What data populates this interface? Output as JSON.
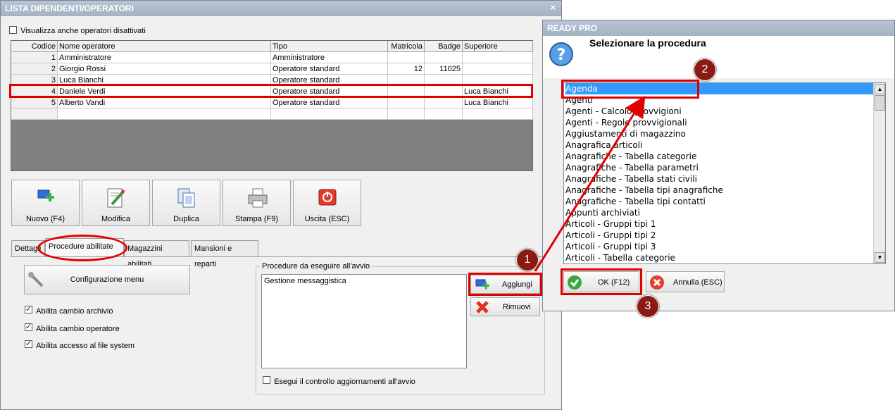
{
  "main_window": {
    "title": "LISTA DIPENDENTI/OPERATORI",
    "close": "×",
    "show_disabled_label": "Visualizza anche operatori disattivati",
    "table": {
      "columns": [
        "Codice",
        "Nome operatore",
        "Tipo",
        "Matricola",
        "Badge",
        "Superiore"
      ],
      "rows": [
        {
          "codice": "1",
          "nome": "Amministratore",
          "tipo": "Amministratore",
          "matricola": "",
          "badge": "",
          "superiore": ""
        },
        {
          "codice": "2",
          "nome": "Giorgio Rossi",
          "tipo": "Operatore standard",
          "matricola": "12",
          "badge": "11025",
          "superiore": ""
        },
        {
          "codice": "3",
          "nome": "Luca Bianchi",
          "tipo": "Operatore standard",
          "matricola": "",
          "badge": "",
          "superiore": ""
        },
        {
          "codice": "4",
          "nome": "Daniele Verdi",
          "tipo": "Operatore standard",
          "matricola": "",
          "badge": "",
          "superiore": "Luca Bianchi"
        },
        {
          "codice": "5",
          "nome": "Alberto Vandi",
          "tipo": "Operatore standard",
          "matricola": "",
          "badge": "",
          "superiore": "Luca Bianchi"
        }
      ]
    },
    "toolbar": {
      "new": "Nuovo (F4)",
      "edit": "Modifica",
      "duplicate": "Duplica",
      "print": "Stampa (F9)",
      "exit": "Uscita (ESC)"
    },
    "tabs": [
      "Dettagli",
      "Procedure abilitate",
      "Magazzini abilitati",
      "Mansioni e reparti"
    ],
    "config_menu_label": "Configurazione menu",
    "options": [
      {
        "label": "Abilita cambio archivio",
        "checked": true
      },
      {
        "label": "Abilita cambio operatore",
        "checked": true
      },
      {
        "label": "Abilita accesso al file system",
        "checked": true
      }
    ],
    "startup_group": {
      "title": "Procedure da eseguire all'avvio",
      "items": [
        "Gestione messaggistica"
      ],
      "add": "Aggiungi",
      "remove": "Rimuovi",
      "check_updates_label": "Esegui il controllo aggiornamenti all'avvio"
    }
  },
  "dialog": {
    "title": "READY PRO",
    "heading": "Selezionare la procedura",
    "items": [
      "Agenda",
      "Agenti",
      "Agenti - Calcolo provvigioni",
      "Agenti - Regole provvigionali",
      "Aggiustamenti di magazzino",
      "Anagrafica articoli",
      "Anagrafiche - Tabella categorie",
      "Anagrafiche - Tabella parametri",
      "Anagrafiche - Tabella stati civili",
      "Anagrafiche - Tabella tipi anagrafiche",
      "Anagrafiche - Tabella tipi contatti",
      "Appunti archiviati",
      "Articoli - Gruppi tipi 1",
      "Articoli - Gruppi tipi 2",
      "Articoli - Gruppi tipi 3",
      "Articoli - Tabella categorie"
    ],
    "ok": "OK (F12)",
    "cancel": "Annulla (ESC)"
  },
  "annotations": {
    "badges": [
      "1",
      "2",
      "3"
    ],
    "color": "#e00000"
  }
}
